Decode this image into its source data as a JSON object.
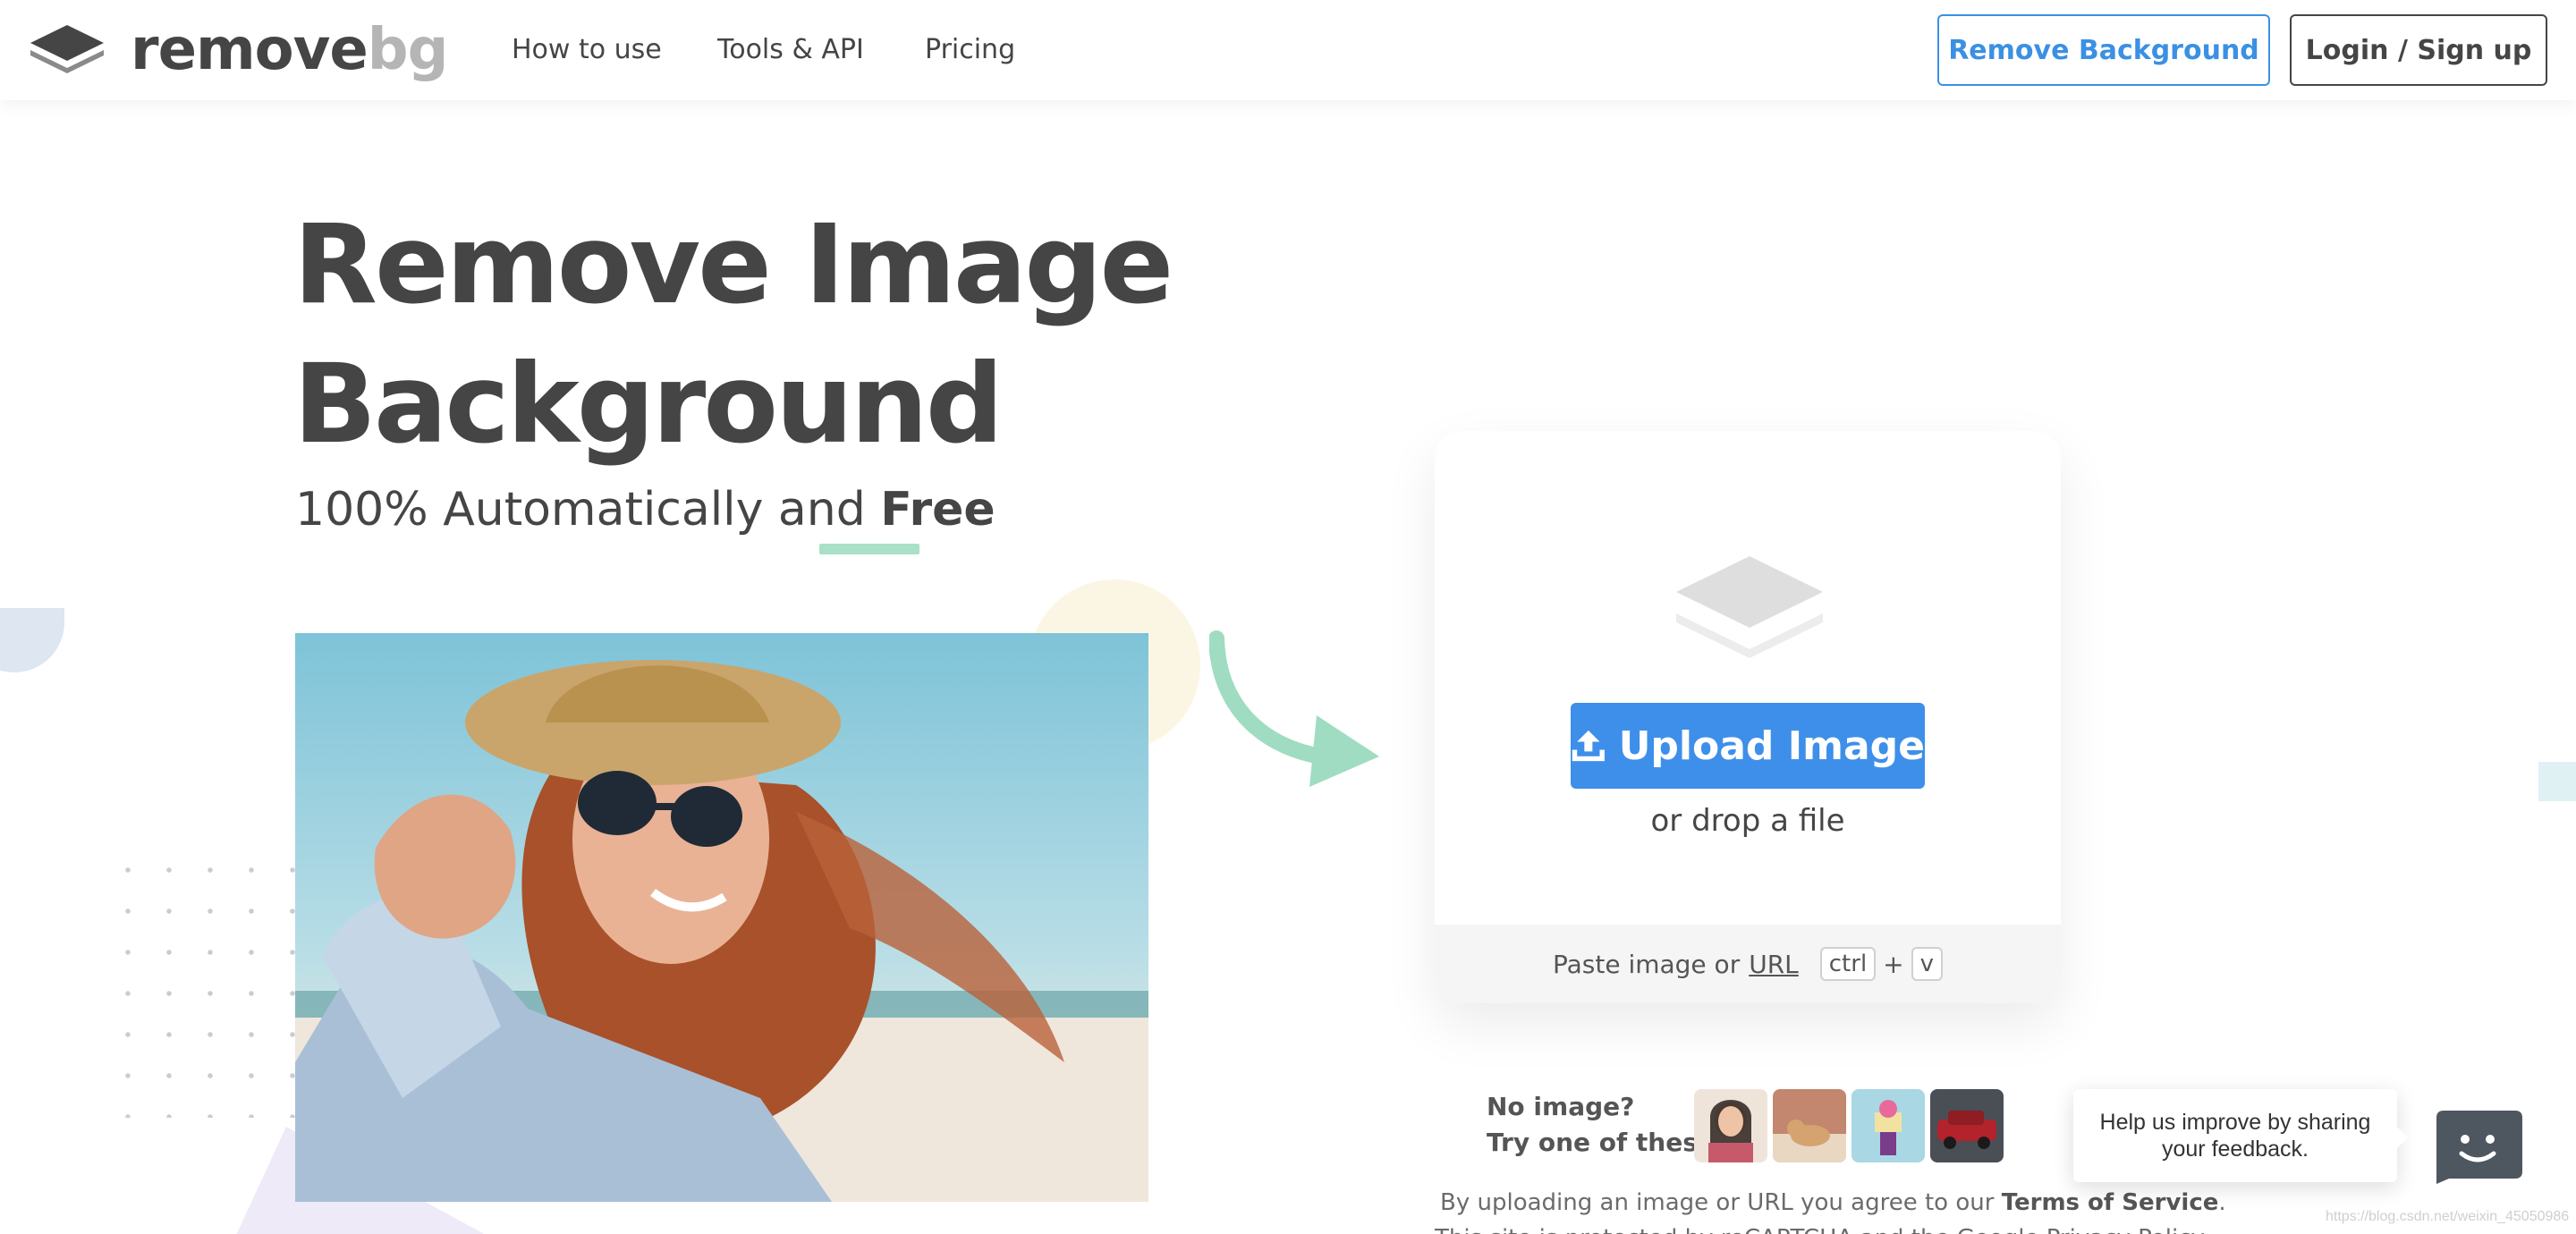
{
  "header": {
    "logo": {
      "word1": "remove",
      "word2": "bg",
      "icon": "layers-logo-icon"
    },
    "nav": [
      {
        "label": "How to use"
      },
      {
        "label": "Tools & API"
      },
      {
        "label": "Pricing"
      }
    ],
    "remove_background_label": "Remove Background",
    "login_label": "Login / Sign up"
  },
  "hero": {
    "title_line1": "Remove Image",
    "title_line2": "Background",
    "subtitle_prefix": "100% Automatically and ",
    "subtitle_emphasis": "Free"
  },
  "upload": {
    "button_label": "Upload Image",
    "button_icon": "upload-icon",
    "drop_text": "or drop a file",
    "paste_prefix": "Paste image or",
    "paste_url": "URL",
    "key_ctrl": "ctrl",
    "key_plus": "+",
    "key_v": "v"
  },
  "samples": {
    "line1": "No image?",
    "line2": "Try one of these:",
    "thumbnails": [
      "woman-portrait",
      "dog",
      "ice-cream-cake",
      "red-car"
    ]
  },
  "legal": {
    "terms_prefix": "By uploading an image or URL you agree to our ",
    "terms_link": "Terms of Service",
    "terms_suffix": ".",
    "captcha_line": "This site is protected by reCAPTCHA and the Google Privacy Policy"
  },
  "feedback": {
    "text": "Help us improve by sharing your feedback."
  },
  "watermark": "https://blog.csdn.net/weixin_45050986",
  "colors": {
    "primary_blue": "#3e8fe9",
    "text_dark": "#454545",
    "accent_green": "#a8e0c8"
  }
}
